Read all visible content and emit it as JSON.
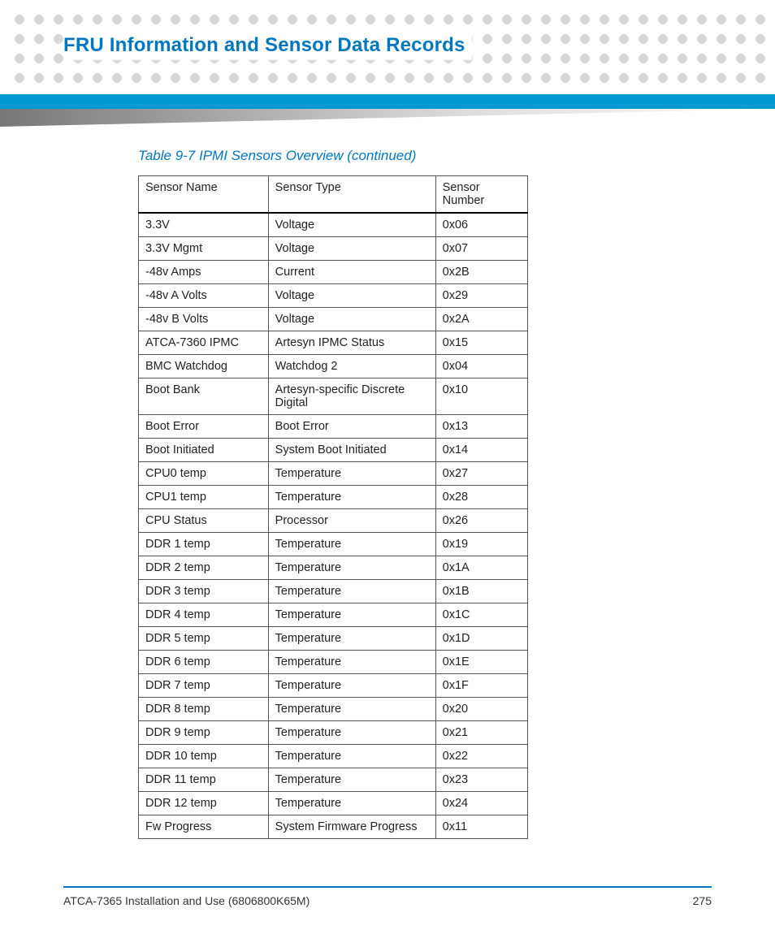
{
  "header": {
    "title": "FRU Information and Sensor Data Records"
  },
  "table": {
    "caption": "Table 9-7 IPMI Sensors Overview (continued)",
    "columns": [
      "Sensor Name",
      "Sensor Type",
      "Sensor Number"
    ],
    "rows": [
      {
        "name": "3.3V",
        "type": "Voltage",
        "num": "0x06"
      },
      {
        "name": "3.3V Mgmt",
        "type": "Voltage",
        "num": "0x07"
      },
      {
        "name": "-48v Amps",
        "type": "Current",
        "num": "0x2B"
      },
      {
        "name": "-48v A Volts",
        "type": "Voltage",
        "num": "0x29"
      },
      {
        "name": "-48v B Volts",
        "type": "Voltage",
        "num": "0x2A"
      },
      {
        "name": "ATCA-7360 IPMC",
        "type": "Artesyn IPMC Status",
        "num": "0x15"
      },
      {
        "name": "BMC Watchdog",
        "type": "Watchdog 2",
        "num": "0x04"
      },
      {
        "name": "Boot Bank",
        "type": "Artesyn-specific Discrete Digital",
        "num": "0x10"
      },
      {
        "name": "Boot Error",
        "type": "Boot Error",
        "num": "0x13"
      },
      {
        "name": "Boot Initiated",
        "type": "System Boot Initiated",
        "num": "0x14"
      },
      {
        "name": "CPU0 temp",
        "type": "Temperature",
        "num": "0x27"
      },
      {
        "name": "CPU1 temp",
        "type": "Temperature",
        "num": "0x28"
      },
      {
        "name": "CPU Status",
        "type": "Processor",
        "num": "0x26"
      },
      {
        "name": "DDR 1 temp",
        "type": "Temperature",
        "num": "0x19"
      },
      {
        "name": "DDR 2 temp",
        "type": "Temperature",
        "num": "0x1A"
      },
      {
        "name": "DDR 3 temp",
        "type": "Temperature",
        "num": "0x1B"
      },
      {
        "name": "DDR 4 temp",
        "type": "Temperature",
        "num": "0x1C"
      },
      {
        "name": "DDR 5 temp",
        "type": "Temperature",
        "num": "0x1D"
      },
      {
        "name": "DDR 6 temp",
        "type": "Temperature",
        "num": "0x1E"
      },
      {
        "name": "DDR 7 temp",
        "type": "Temperature",
        "num": "0x1F"
      },
      {
        "name": "DDR 8 temp",
        "type": "Temperature",
        "num": "0x20"
      },
      {
        "name": "DDR 9 temp",
        "type": "Temperature",
        "num": "0x21"
      },
      {
        "name": "DDR 10 temp",
        "type": "Temperature",
        "num": "0x22"
      },
      {
        "name": "DDR 11 temp",
        "type": "Temperature",
        "num": "0x23"
      },
      {
        "name": "DDR 12 temp",
        "type": "Temperature",
        "num": "0x24"
      },
      {
        "name": "Fw Progress",
        "type": "System Firmware Progress",
        "num": "0x11"
      }
    ]
  },
  "footer": {
    "doc_title": "ATCA-7365 Installation and Use (6806800K65M)",
    "page_number": "275"
  }
}
